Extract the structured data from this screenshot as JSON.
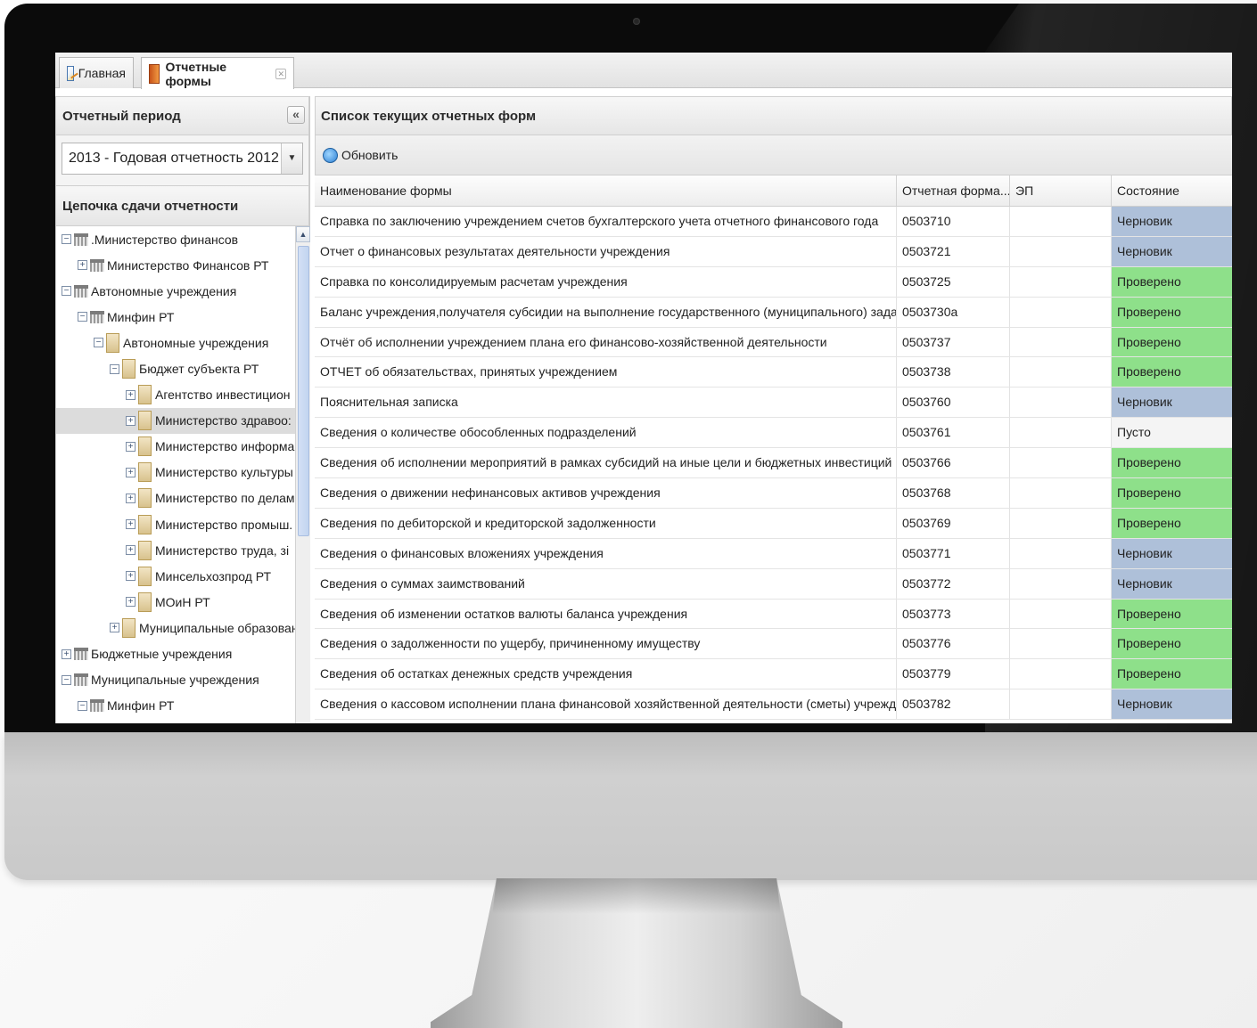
{
  "tabs": [
    {
      "label": "Главная",
      "icon": "home-icon"
    },
    {
      "label": "Отчетные формы",
      "icon": "forms-icon",
      "close": "✕"
    }
  ],
  "left_panel": {
    "period_title": "Отчетный период",
    "collapse_glyph": "«",
    "period_value": "2013 - Годовая отчетность 2012",
    "chain_title": "Цепочка сдачи отчетности",
    "tree": [
      {
        "label": ".Министерство финансов",
        "level": 0,
        "expander": "−",
        "icon": "gov"
      },
      {
        "label": "Министерство Финансов РТ",
        "level": 1,
        "expander": "+",
        "icon": "gov"
      },
      {
        "label": "Автономные учреждения",
        "level": 0,
        "expander": "−",
        "icon": "gov"
      },
      {
        "label": "Минфин РТ",
        "level": 1,
        "expander": "−",
        "icon": "gov"
      },
      {
        "label": "Автономные учреждения",
        "level": 2,
        "expander": "−",
        "icon": "bld"
      },
      {
        "label": "Бюджет субъекта РТ",
        "level": 3,
        "expander": "−",
        "icon": "bld"
      },
      {
        "label": "Агентство инвестицион",
        "level": 4,
        "expander": "+",
        "icon": "bld"
      },
      {
        "label": "Министерство здравоо:",
        "level": 4,
        "expander": "+",
        "icon": "bld",
        "selected": true
      },
      {
        "label": "Министерство информа",
        "level": 4,
        "expander": "+",
        "icon": "bld"
      },
      {
        "label": "Министерство культуры",
        "level": 4,
        "expander": "+",
        "icon": "bld"
      },
      {
        "label": "Министерство по делам",
        "level": 4,
        "expander": "+",
        "icon": "bld"
      },
      {
        "label": "Министерство промыш.",
        "level": 4,
        "expander": "+",
        "icon": "bld"
      },
      {
        "label": "Министерство труда, зі",
        "level": 4,
        "expander": "+",
        "icon": "bld"
      },
      {
        "label": "Минсельхозпрод РТ",
        "level": 4,
        "expander": "+",
        "icon": "bld"
      },
      {
        "label": "МОиН РТ",
        "level": 4,
        "expander": "+",
        "icon": "bld"
      },
      {
        "label": "Муниципальные образован",
        "level": 3,
        "expander": "+",
        "icon": "bld"
      },
      {
        "label": "Бюджетные учреждения",
        "level": 0,
        "expander": "+",
        "icon": "gov"
      },
      {
        "label": "Муниципальные учреждения",
        "level": 0,
        "expander": "−",
        "icon": "gov"
      },
      {
        "label": "Минфин РТ",
        "level": 1,
        "expander": "−",
        "icon": "gov"
      }
    ]
  },
  "right_panel": {
    "title": "Список текущих отчетных форм",
    "refresh_label": "Обновить",
    "columns": [
      "Наименование формы",
      "Отчетная форма...",
      "ЭП",
      "Состояние"
    ],
    "rows": [
      {
        "name": "Справка по заключению учреждением счетов бухгалтерского учета отчетного финансового года",
        "code": "0503710",
        "sig": "",
        "state": "Черновик",
        "kind": "draft"
      },
      {
        "name": "Отчет о финансовых результатах деятельности учреждения",
        "code": "0503721",
        "sig": "",
        "state": "Черновик",
        "kind": "draft"
      },
      {
        "name": "Справка по консолидируемым расчетам учреждения",
        "code": "0503725",
        "sig": "",
        "state": "Проверено",
        "kind": "ok"
      },
      {
        "name": "Баланс учреждения,получателя субсидии на выполнение государственного (муниципального) задания",
        "code": "0503730a",
        "sig": "",
        "state": "Проверено",
        "kind": "ok"
      },
      {
        "name": "Отчёт об исполнении учреждением плана его финансово-хозяйственной деятельности",
        "code": "0503737",
        "sig": "",
        "state": "Проверено",
        "kind": "ok"
      },
      {
        "name": "ОТЧЕТ об обязательствах, принятых учреждением",
        "code": "0503738",
        "sig": "",
        "state": "Проверено",
        "kind": "ok"
      },
      {
        "name": "Пояснительная записка",
        "code": "0503760",
        "sig": "",
        "state": "Черновик",
        "kind": "draft"
      },
      {
        "name": "Сведения о количестве обособленных подразделений",
        "code": "0503761",
        "sig": "",
        "state": "Пусто",
        "kind": "empty"
      },
      {
        "name": "Сведения об исполнении мероприятий в рамках субсидий на иные цели и бюджетных инвестиций",
        "code": "0503766",
        "sig": "",
        "state": "Проверено",
        "kind": "ok"
      },
      {
        "name": "Сведения о движении нефинансовых активов учреждения",
        "code": "0503768",
        "sig": "",
        "state": "Проверено",
        "kind": "ok"
      },
      {
        "name": "Сведения по дебиторской и кредиторской задолженности",
        "code": "0503769",
        "sig": "",
        "state": "Проверено",
        "kind": "ok"
      },
      {
        "name": "Сведения о финансовых вложениях учреждения",
        "code": "0503771",
        "sig": "",
        "state": "Черновик",
        "kind": "draft"
      },
      {
        "name": "Сведения о суммах заимствований",
        "code": "0503772",
        "sig": "",
        "state": "Черновик",
        "kind": "draft"
      },
      {
        "name": "Сведения об изменении остатков валюты баланса учреждения",
        "code": "0503773",
        "sig": "",
        "state": "Проверено",
        "kind": "ok"
      },
      {
        "name": "Сведения о задолженности по ущербу, причиненному имуществу",
        "code": "0503776",
        "sig": "",
        "state": "Проверено",
        "kind": "ok"
      },
      {
        "name": "Сведения об остатках денежных средств учреждения",
        "code": "0503779",
        "sig": "",
        "state": "Проверено",
        "kind": "ok"
      },
      {
        "name": "Сведения о кассовом исполнении плана финансовой хозяйственной деятельности (сметы) учреждения",
        "code": "0503782",
        "sig": "",
        "state": "Черновик",
        "kind": "draft"
      }
    ]
  },
  "colors": {
    "draft": "#aec0d9",
    "ok": "#8ee08a",
    "empty": "#f4f4f4"
  }
}
